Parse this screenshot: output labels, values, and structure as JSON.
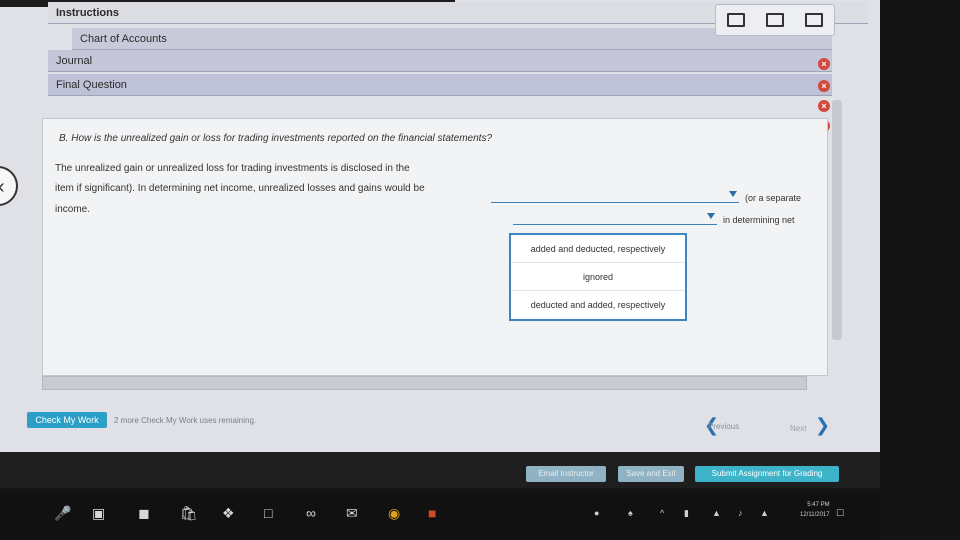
{
  "tabs": {
    "instructions": "Instructions",
    "chart_of_accounts": "Chart of Accounts",
    "journal": "Journal",
    "final_question": "Final Question"
  },
  "question": {
    "prompt": "B. How is the unrealized gain or loss for trading investments reported on the financial statements?",
    "line1": "The unrealized gain or unrealized loss for trading investments is disclosed in the",
    "line2": "item if significant). In determining net income, unrealized losses and gains would be",
    "line3": "income.",
    "after_select1": "(or a separate",
    "after_select2": "in determining net"
  },
  "dropdown_options": [
    "added and deducted, respectively",
    "ignored",
    "deducted and added, respectively"
  ],
  "footer": {
    "check_my_work": "Check My Work",
    "remaining": "2 more Check My Work uses remaining.",
    "previous": "Previous",
    "next": "Next",
    "email_instructor": "Email Instructor",
    "save_and_exit": "Save and Exit",
    "submit": "Submit Assignment for Grading"
  },
  "clock": {
    "time": "5:47 PM",
    "date": "12/11/2017"
  },
  "colors": {
    "accent": "#2c9fc7",
    "error": "#d24a3d",
    "link": "#2a6fb0"
  }
}
